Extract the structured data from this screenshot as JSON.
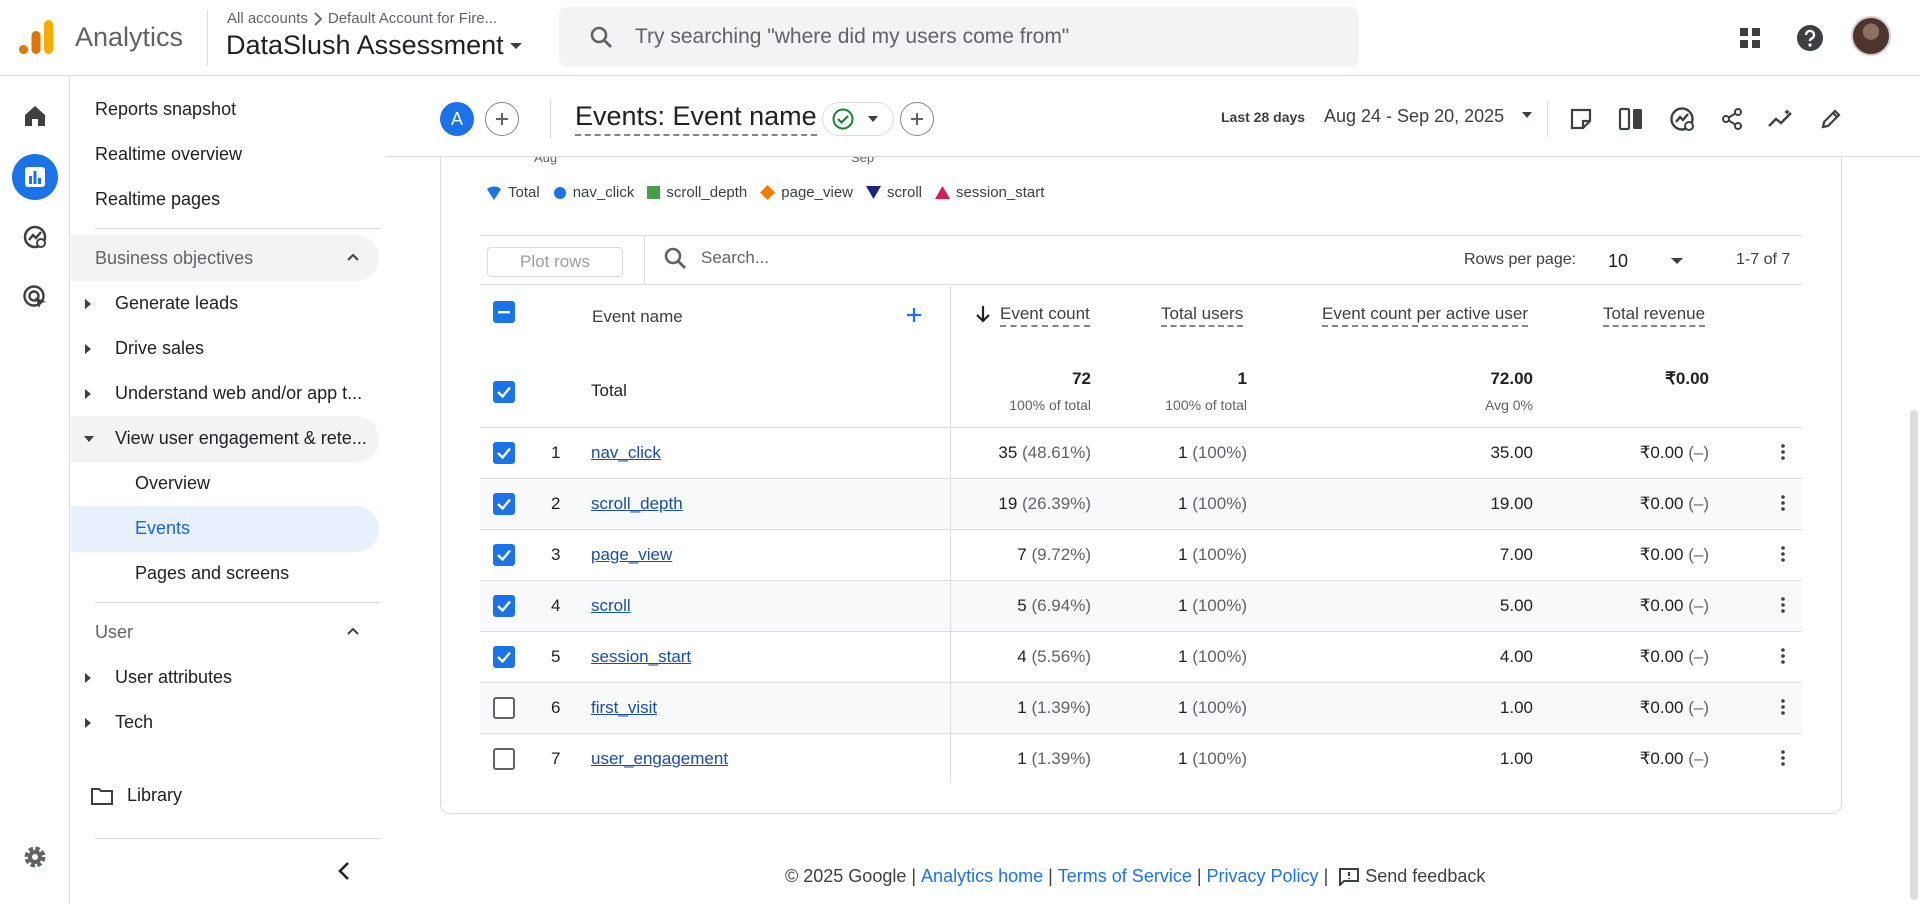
{
  "app": {
    "brand": "Analytics",
    "breadcrumb_all": "All accounts",
    "breadcrumb_account": "Default Account for Fire...",
    "property": "DataSlush Assessment",
    "search_placeholder": "Try searching \"where did my users come from\""
  },
  "icons": {
    "top": [
      "apps-grid-icon",
      "help-icon",
      "account-avatar"
    ],
    "rail": [
      "home-icon",
      "reports-icon",
      "explore-icon",
      "advertising-icon",
      "settings-icon"
    ]
  },
  "colors": {
    "accent": "#1a73e8",
    "selected_nav_bg": "#e8f0fe",
    "legend": {
      "Total": "#1a73e8",
      "nav_click": "#1a73e8",
      "scroll_depth": "#43a047",
      "page_view": "#f57c00",
      "scroll": "#1a237e",
      "session_start": "#d81b60"
    }
  },
  "sidebar": {
    "top_items": [
      "Reports snapshot",
      "Realtime overview",
      "Realtime pages"
    ],
    "business_objectives": {
      "title": "Business objectives",
      "items": [
        "Generate leads",
        "Drive sales",
        "Understand web and/or app t...",
        "View user engagement & rete..."
      ],
      "sub_items": [
        "Overview",
        "Events",
        "Pages and screens"
      ],
      "selected_sub": "Events"
    },
    "user": {
      "title": "User",
      "items": [
        "User attributes",
        "Tech"
      ]
    },
    "library": "Library"
  },
  "report": {
    "comparison_label": "A",
    "title": "Events: Event name",
    "date_label": "Last 28 days",
    "date_range": "Aug 24 - Sep 20, 2025"
  },
  "chart_axis": {
    "x_ticks": [
      "Aug",
      "Sep"
    ]
  },
  "legend": [
    {
      "name": "Total",
      "shape": "pin"
    },
    {
      "name": "nav_click",
      "shape": "circle"
    },
    {
      "name": "scroll_depth",
      "shape": "square"
    },
    {
      "name": "page_view",
      "shape": "diamond"
    },
    {
      "name": "scroll",
      "shape": "triangle-down"
    },
    {
      "name": "session_start",
      "shape": "triangle-up"
    }
  ],
  "table": {
    "plot_rows_label": "Plot rows",
    "search_placeholder": "Search...",
    "rows_per_page_label": "Rows per page:",
    "rows_per_page": "10",
    "pagination": "1-7 of 7",
    "columns": {
      "event_name": "Event name",
      "event_count": "Event count",
      "total_users": "Total users",
      "event_count_per_user": "Event count per active user",
      "total_revenue": "Total revenue"
    },
    "totals": {
      "label": "Total",
      "event_count": "72",
      "event_count_sub": "100% of total",
      "total_users": "1",
      "total_users_sub": "100% of total",
      "per_user": "72.00",
      "per_user_sub": "Avg 0%",
      "revenue": "₹0.00"
    },
    "rows": [
      {
        "idx": "1",
        "name": "nav_click",
        "checked": true,
        "count": "35",
        "count_pct": "(48.61%)",
        "users": "1",
        "users_pct": "(100%)",
        "per_user": "35.00",
        "revenue": "₹0.00",
        "revenue_pct": "(–)"
      },
      {
        "idx": "2",
        "name": "scroll_depth",
        "checked": true,
        "count": "19",
        "count_pct": "(26.39%)",
        "users": "1",
        "users_pct": "(100%)",
        "per_user": "19.00",
        "revenue": "₹0.00",
        "revenue_pct": "(–)"
      },
      {
        "idx": "3",
        "name": "page_view",
        "checked": true,
        "count": "7",
        "count_pct": "(9.72%)",
        "users": "1",
        "users_pct": "(100%)",
        "per_user": "7.00",
        "revenue": "₹0.00",
        "revenue_pct": "(–)"
      },
      {
        "idx": "4",
        "name": "scroll",
        "checked": true,
        "count": "5",
        "count_pct": "(6.94%)",
        "users": "1",
        "users_pct": "(100%)",
        "per_user": "5.00",
        "revenue": "₹0.00",
        "revenue_pct": "(–)"
      },
      {
        "idx": "5",
        "name": "session_start",
        "checked": true,
        "count": "4",
        "count_pct": "(5.56%)",
        "users": "1",
        "users_pct": "(100%)",
        "per_user": "4.00",
        "revenue": "₹0.00",
        "revenue_pct": "(–)"
      },
      {
        "idx": "6",
        "name": "first_visit",
        "checked": false,
        "count": "1",
        "count_pct": "(1.39%)",
        "users": "1",
        "users_pct": "(100%)",
        "per_user": "1.00",
        "revenue": "₹0.00",
        "revenue_pct": "(–)"
      },
      {
        "idx": "7",
        "name": "user_engagement",
        "checked": false,
        "count": "1",
        "count_pct": "(1.39%)",
        "users": "1",
        "users_pct": "(100%)",
        "per_user": "1.00",
        "revenue": "₹0.00",
        "revenue_pct": "(–)"
      }
    ]
  },
  "footer": {
    "copyright": "© 2025 Google",
    "links": [
      "Analytics home",
      "Terms of Service",
      "Privacy Policy"
    ],
    "feedback": "Send feedback"
  }
}
